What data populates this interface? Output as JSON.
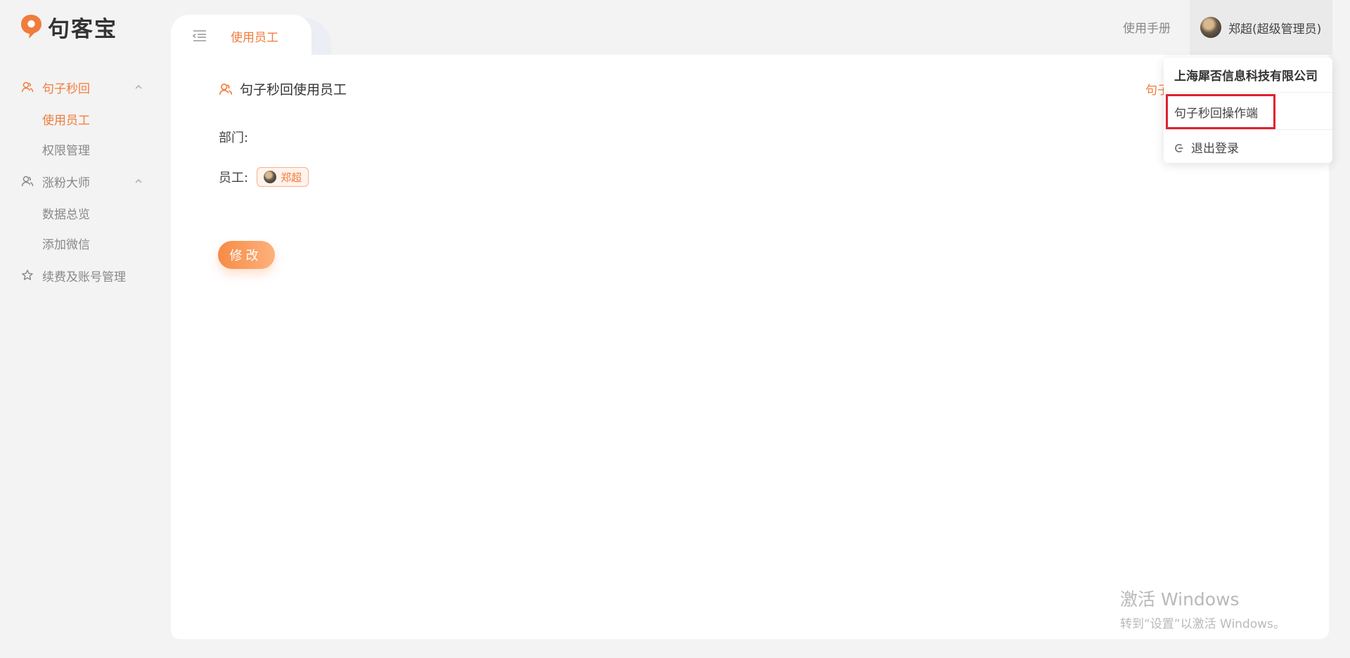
{
  "app": {
    "logo_text": "句客宝",
    "accent_color": "#f07c3c"
  },
  "sidebar": {
    "groups": [
      {
        "label": "句子秒回",
        "icon": "users-icon",
        "expanded": true,
        "active": true,
        "items": [
          {
            "label": "使用员工",
            "active": true
          },
          {
            "label": "权限管理",
            "active": false
          }
        ]
      },
      {
        "label": "涨粉大师",
        "icon": "users-icon",
        "expanded": true,
        "active": false,
        "items": [
          {
            "label": "数据总览",
            "active": false
          },
          {
            "label": "添加微信",
            "active": false
          }
        ]
      },
      {
        "label": "续费及账号管理",
        "icon": "star-icon",
        "expanded": false,
        "active": false,
        "items": []
      }
    ]
  },
  "tabs": {
    "active_label": "使用员工"
  },
  "header": {
    "manual_link": "使用手册",
    "user_name": "郑超(超级管理员)"
  },
  "main": {
    "title": "句子秒回使用员工",
    "top_right_link": "句子",
    "department_label": "部门:",
    "employee_label": "员工:",
    "employees": [
      {
        "name": "郑超"
      }
    ],
    "edit_button": "修改"
  },
  "dropdown": {
    "company": "上海犀否信息科技有限公司",
    "operator_item": "句子秒回操作端",
    "logout": "退出登录"
  },
  "watermark": {
    "line1": "激活 Windows",
    "line2": "转到“设置”以激活 Windows。"
  }
}
